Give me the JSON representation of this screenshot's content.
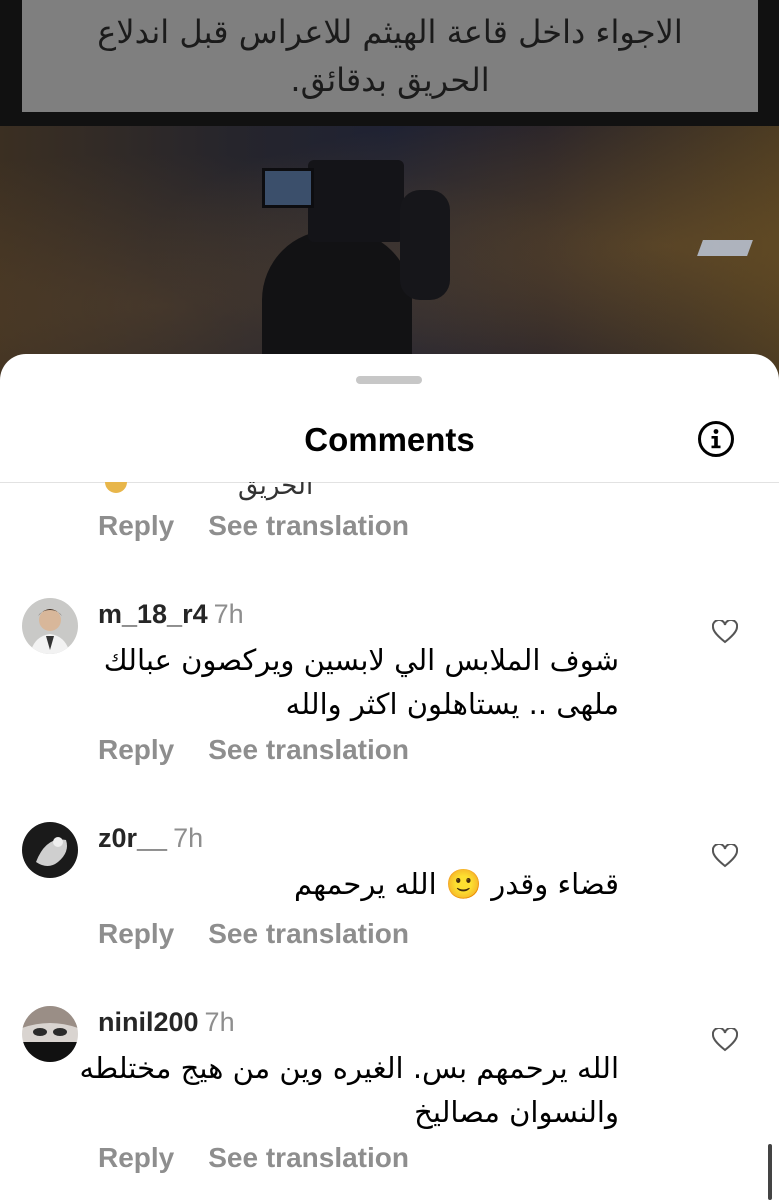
{
  "post": {
    "caption_line1": "الاجواء داخل قاعة الهيثم للاعراس قبل اندلاع",
    "caption_line2": "الحريق بدقائق."
  },
  "sheet": {
    "title": "Comments",
    "info_icon": "info-circle-icon"
  },
  "actions": {
    "reply": "Reply",
    "see_translation": "See translation"
  },
  "clipped_comment": {
    "text": "الحريق"
  },
  "comments": [
    {
      "username": "m_18_r4",
      "time": "7h",
      "line1": "شوف الملابس الي لابسين ويركصون عبالك",
      "line2": "ملهى .. يستاهلون اكثر والله",
      "icon": "heart-outline-icon"
    },
    {
      "username": "z0r__",
      "time": "7h",
      "line1": "قضاء وقدر 🙂 الله يرحمهم",
      "icon": "heart-outline-icon"
    },
    {
      "username": "ninil200",
      "time": "7h",
      "line1": "الله يرحمهم بس. الغيره وين من هيج مختلطه",
      "line2": "والنسوان مصاليخ",
      "icon": "heart-outline-icon"
    }
  ],
  "colors": {
    "sheet_bg": "#ffffff",
    "muted": "#8e8e8e",
    "text": "#000000"
  }
}
